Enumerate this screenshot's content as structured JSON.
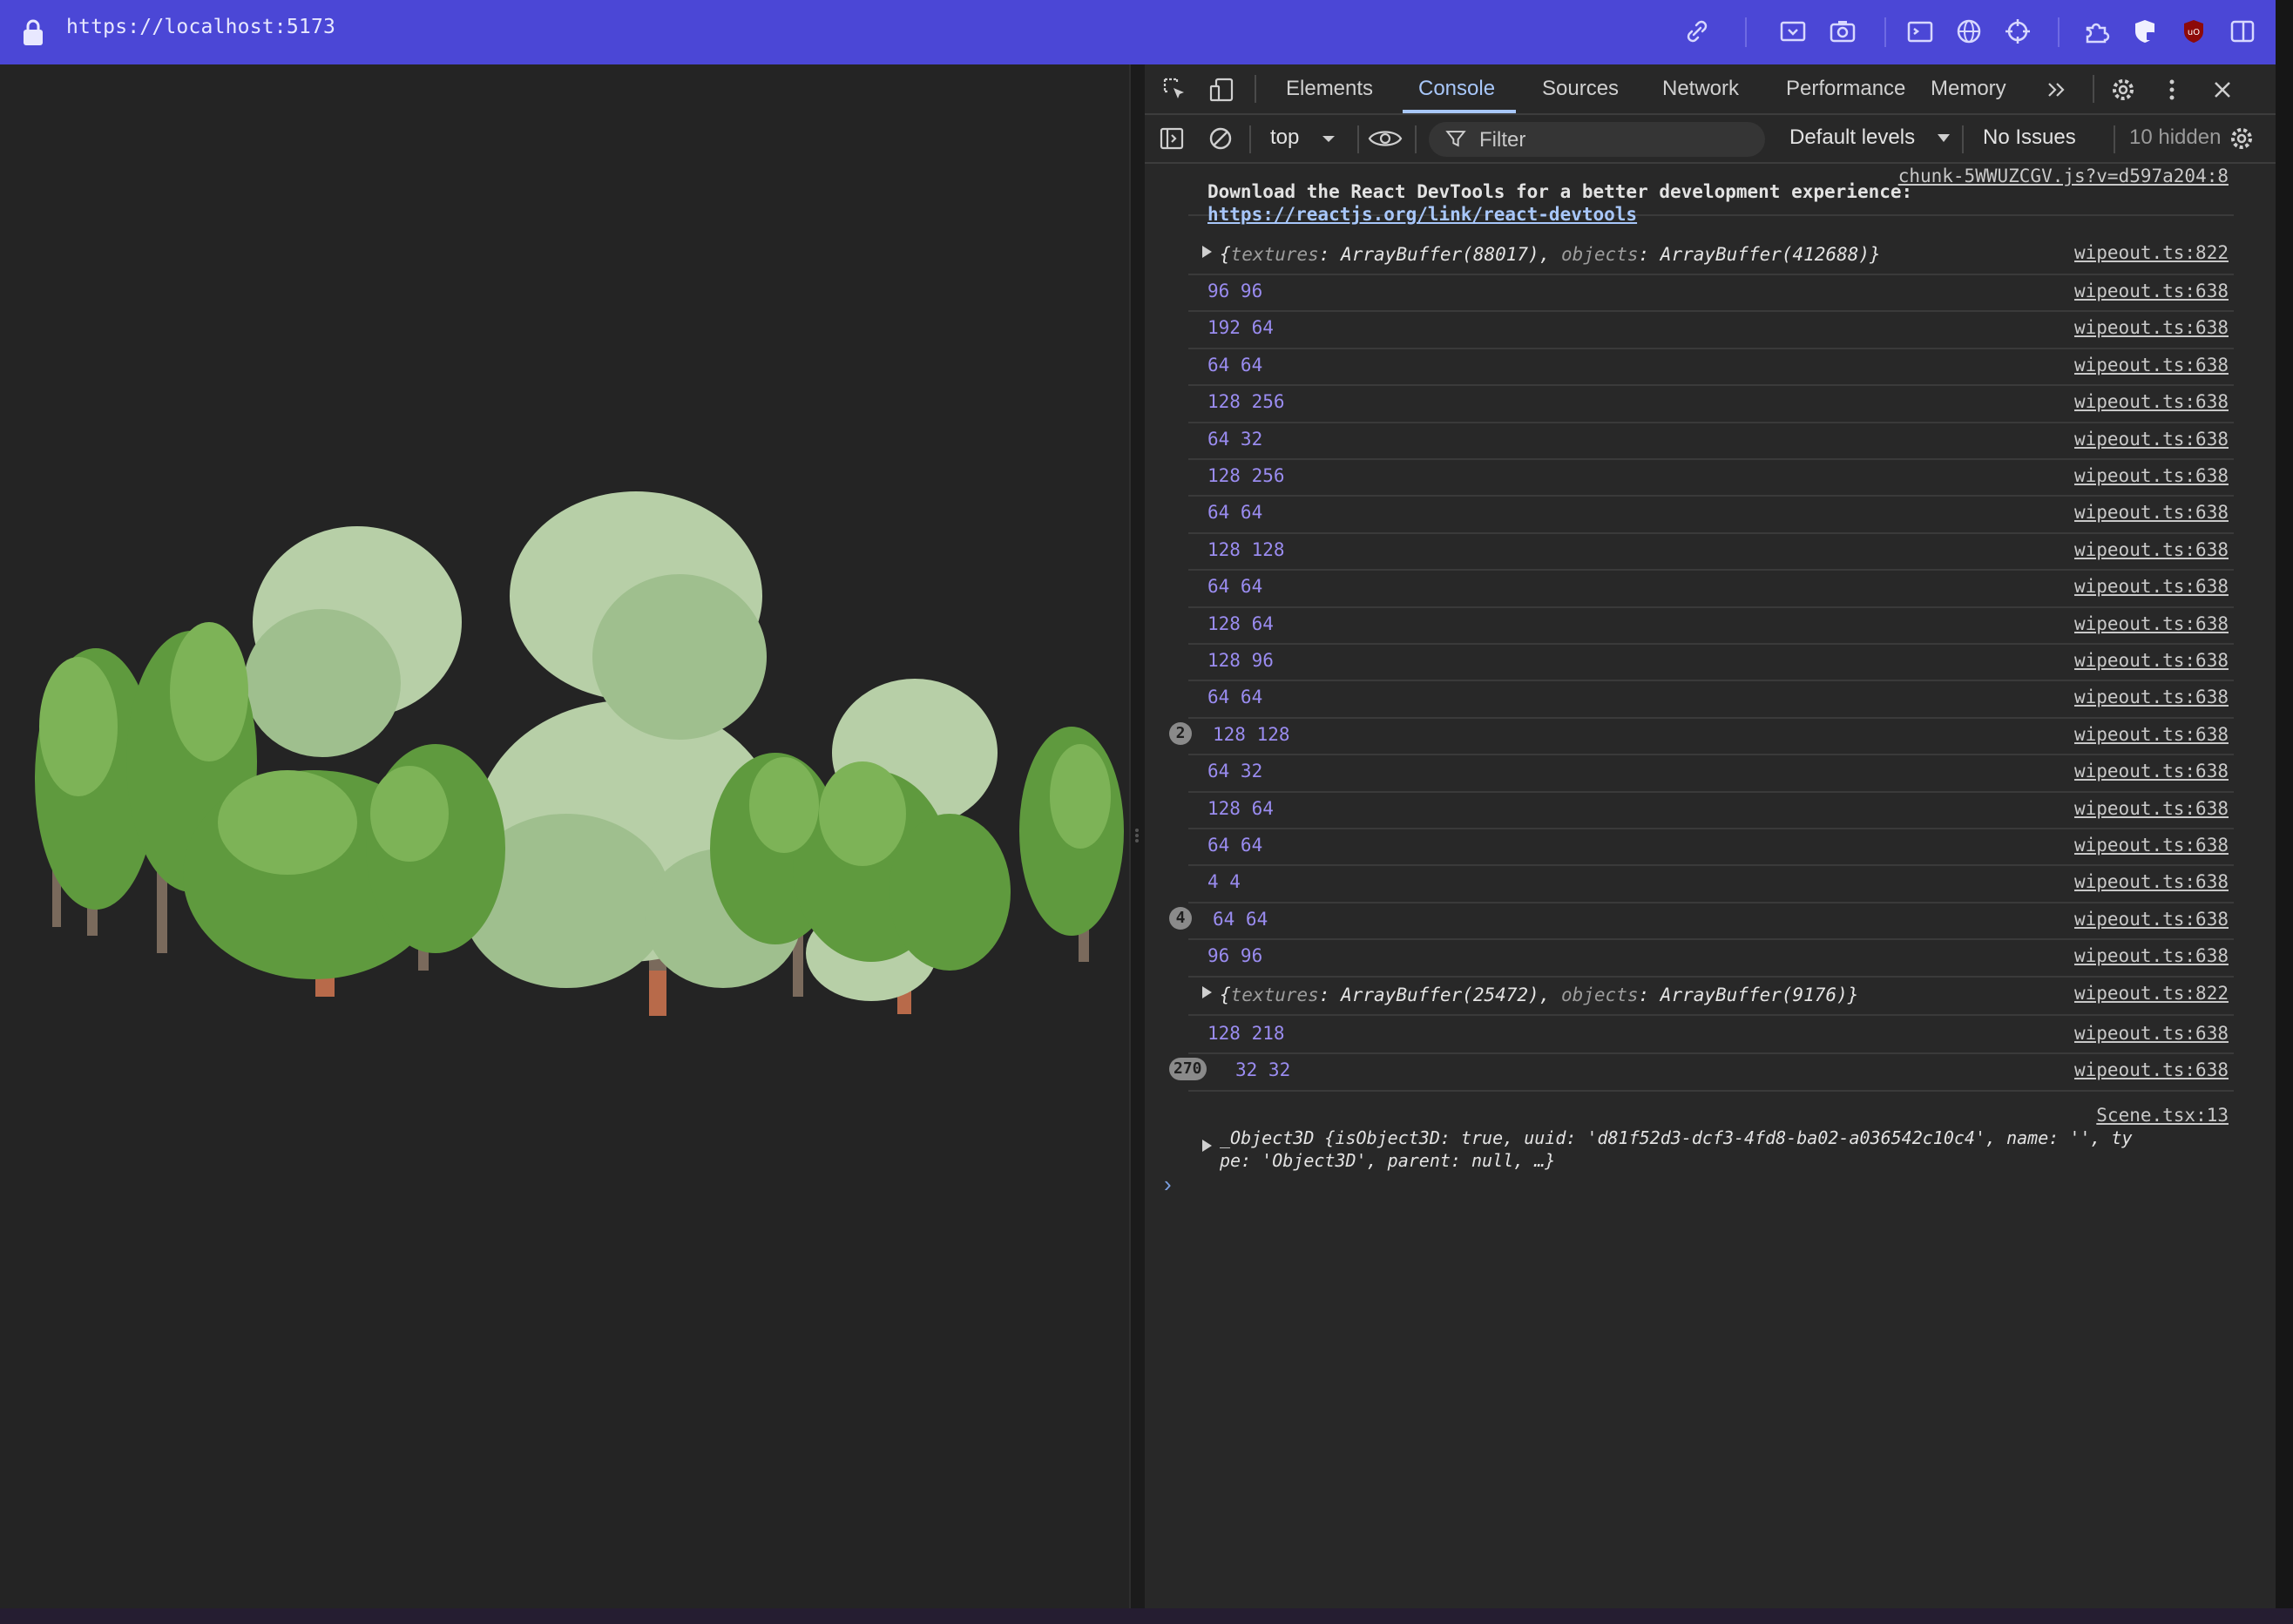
{
  "browser": {
    "url": "https://localhost:5173",
    "icons": [
      "lock-icon",
      "link-icon",
      "screen-capture-icon",
      "camera-icon",
      "terminal-icon",
      "globe-icon",
      "crosshair-icon",
      "extensions-icon",
      "shield-icon",
      "ublock-icon",
      "split-view-icon"
    ]
  },
  "devtools": {
    "tabs": [
      {
        "label": "Elements"
      },
      {
        "label": "Console"
      },
      {
        "label": "Sources"
      },
      {
        "label": "Network"
      },
      {
        "label": "Performance"
      },
      {
        "label": "Memory"
      }
    ],
    "active_tab": "Console",
    "toolbar": {
      "context": "top",
      "filter_placeholder": "Filter",
      "levels": "Default levels",
      "issues": "No Issues",
      "hidden": "10 hidden"
    },
    "console": {
      "react_notice": {
        "source": "chunk-5WWUZCGV.js?v=d597a204:8",
        "line1": "Download the React DevTools for a better development experience:",
        "link": "https://reactjs.org/link/react-devtools"
      },
      "object_logs": [
        {
          "text_prefix": "{",
          "textures_key": "textures",
          "textures_val": "ArrayBuffer(88017)",
          "objects_key": "objects",
          "objects_val": "ArrayBuffer(412688)",
          "text_suffix": "}",
          "source": "wipeout.ts:822"
        },
        {
          "text_prefix": "{",
          "textures_key": "textures",
          "textures_val": "ArrayBuffer(25472)",
          "objects_key": "objects",
          "objects_val": "ArrayBuffer(9176)",
          "text_suffix": "}",
          "source": "wipeout.ts:822"
        }
      ],
      "logs_a": [
        {
          "msg": "96 96",
          "source": "wipeout.ts:638"
        },
        {
          "msg": "192 64",
          "source": "wipeout.ts:638"
        },
        {
          "msg": "64 64",
          "source": "wipeout.ts:638"
        },
        {
          "msg": "128 256",
          "source": "wipeout.ts:638"
        },
        {
          "msg": "64 32",
          "source": "wipeout.ts:638"
        },
        {
          "msg": "128 256",
          "source": "wipeout.ts:638"
        },
        {
          "msg": "64 64",
          "source": "wipeout.ts:638"
        },
        {
          "msg": "128 128",
          "source": "wipeout.ts:638"
        },
        {
          "msg": "64 64",
          "source": "wipeout.ts:638"
        },
        {
          "msg": "128 64",
          "source": "wipeout.ts:638"
        },
        {
          "msg": "128 96",
          "source": "wipeout.ts:638"
        },
        {
          "msg": "64 64",
          "source": "wipeout.ts:638"
        },
        {
          "msg": "128 128",
          "source": "wipeout.ts:638",
          "count": "2"
        },
        {
          "msg": "64 32",
          "source": "wipeout.ts:638"
        },
        {
          "msg": "128 64",
          "source": "wipeout.ts:638"
        },
        {
          "msg": "64 64",
          "source": "wipeout.ts:638"
        },
        {
          "msg": "4 4",
          "source": "wipeout.ts:638"
        },
        {
          "msg": "64 64",
          "source": "wipeout.ts:638",
          "count": "4"
        },
        {
          "msg": "96 96",
          "source": "wipeout.ts:638"
        }
      ],
      "logs_b": [
        {
          "msg": "128 218",
          "source": "wipeout.ts:638"
        },
        {
          "msg": "32 32",
          "source": "wipeout.ts:638",
          "count": "270"
        }
      ],
      "object3d": {
        "source": "Scene.tsx:13",
        "line1": "_Object3D {isObject3D: true, uuid: 'd81f52d3-dcf3-4fd8-ba02-a036542c10c4', name: '', ty",
        "line2": "pe: 'Object3D', parent: null, …}"
      }
    }
  },
  "colors": {
    "topbar": "#4b47d6",
    "log_text": "#9a8cf0",
    "active_tab": "#a8c7fa"
  }
}
